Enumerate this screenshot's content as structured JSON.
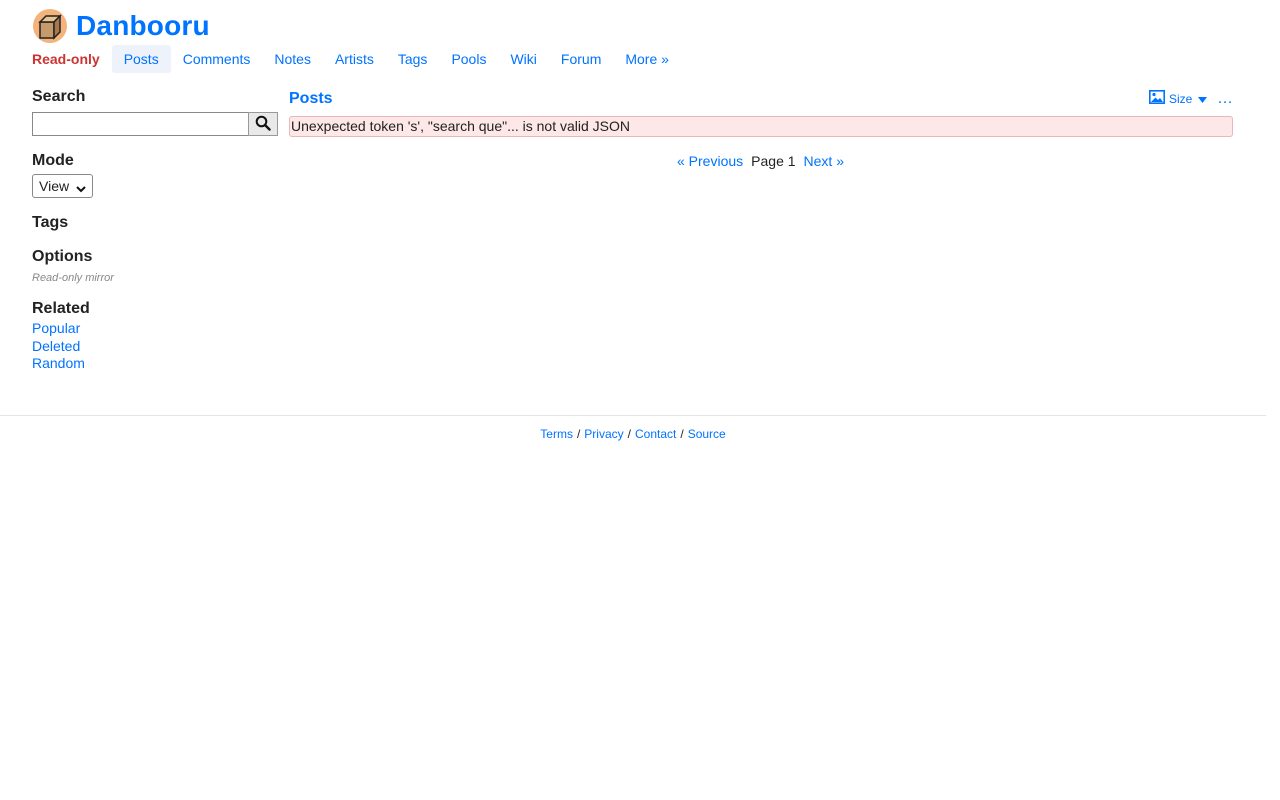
{
  "header": {
    "app_name": "Danbooru",
    "readonly_label": "Read-only"
  },
  "nav": {
    "items": [
      {
        "label": "Posts",
        "current": true
      },
      {
        "label": "Comments"
      },
      {
        "label": "Notes"
      },
      {
        "label": "Artists"
      },
      {
        "label": "Tags"
      },
      {
        "label": "Pools"
      },
      {
        "label": "Wiki"
      },
      {
        "label": "Forum"
      },
      {
        "label": "More »"
      }
    ]
  },
  "sidebar": {
    "search_heading": "Search",
    "search_value": "",
    "mode_heading": "Mode",
    "mode_selected": "View",
    "tags_heading": "Tags",
    "options_heading": "Options",
    "options_note": "Read-only mirror",
    "related_heading": "Related",
    "related_links": [
      "Popular",
      "Deleted",
      "Random"
    ]
  },
  "content": {
    "title": "Posts",
    "size_label": "Size",
    "more_label": "…",
    "error_message": "Unexpected token 's', \"search que\"... is not valid JSON"
  },
  "paginator": {
    "prev": "« Previous",
    "current": "Page 1",
    "next": "Next »"
  },
  "footer": {
    "links": [
      "Terms",
      "Privacy",
      "Contact",
      "Source"
    ],
    "separator": "/"
  },
  "colors": {
    "link": "#0073ff",
    "readonly": "#cc3333",
    "error_bg": "#fde7e7"
  }
}
